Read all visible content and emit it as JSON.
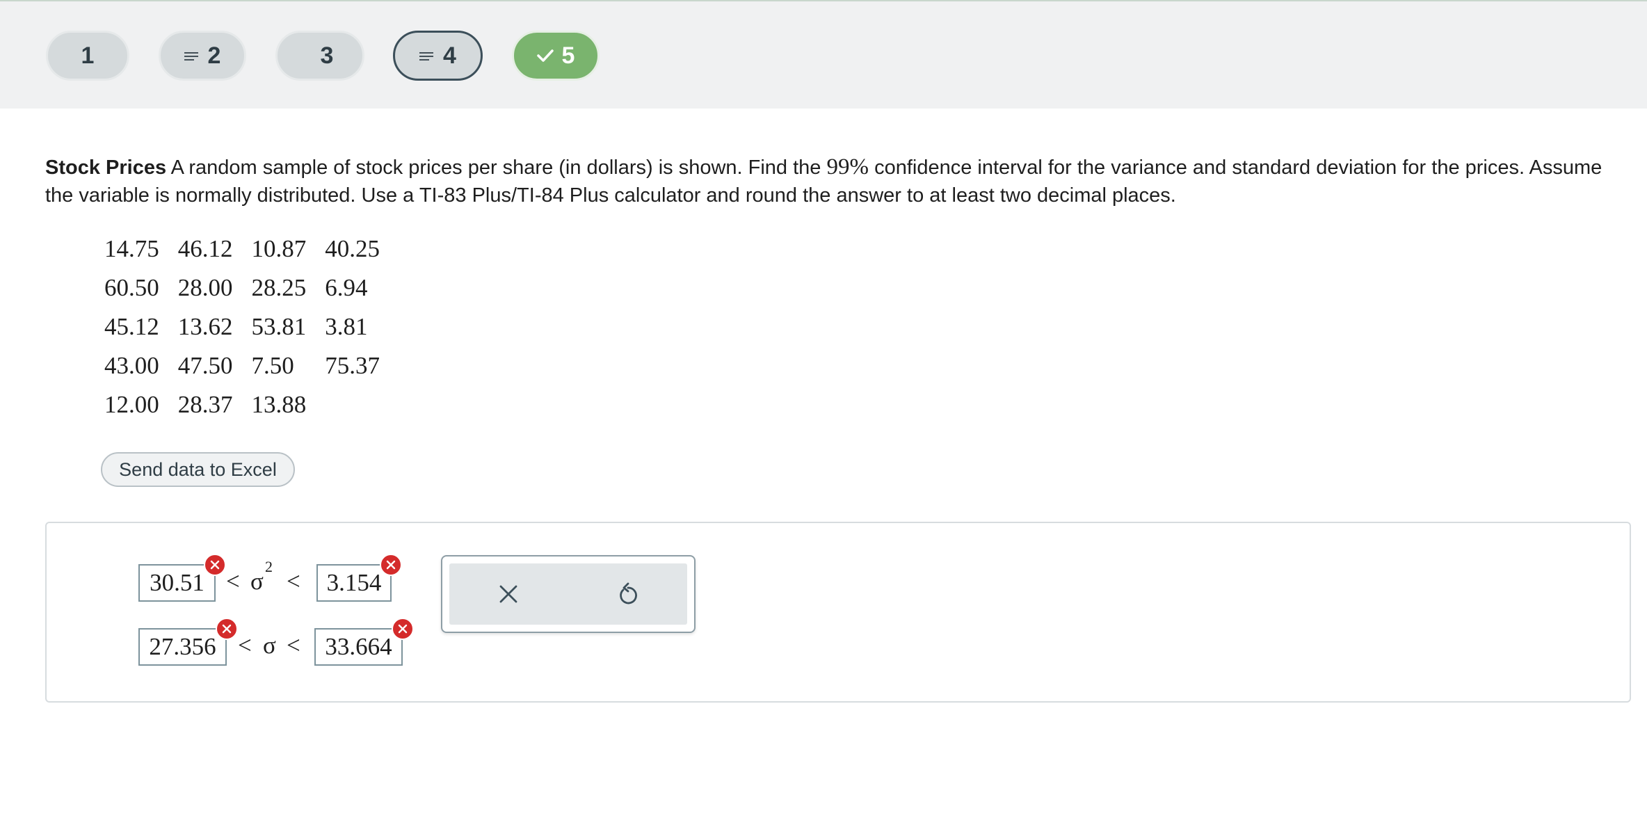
{
  "nav": {
    "pills": [
      {
        "number": "1",
        "state": "default"
      },
      {
        "number": "2",
        "state": "has-notes"
      },
      {
        "number": "3",
        "state": "default"
      },
      {
        "number": "4",
        "state": "active-has-notes"
      },
      {
        "number": "5",
        "state": "correct"
      }
    ]
  },
  "question": {
    "title": "Stock Prices",
    "text_before": "A random sample of stock prices per share (in dollars) is shown. Find the",
    "confidence": "99%",
    "text_after": "confidence interval for the variance and standard deviation for the prices. Assume the variable is normally distributed. Use a TI-83 Plus/TI-84 Plus calculator and round the answer to at least two decimal places."
  },
  "data_table": {
    "rows": [
      [
        "14.75",
        "46.12",
        "10.87",
        "40.25"
      ],
      [
        "60.50",
        "28.00",
        "28.25",
        "6.94"
      ],
      [
        "45.12",
        "13.62",
        "53.81",
        "3.81"
      ],
      [
        "43.00",
        "47.50",
        "7.50",
        "75.37"
      ],
      [
        "12.00",
        "28.37",
        "13.88",
        ""
      ]
    ]
  },
  "excel_button": {
    "label": "Send data to Excel"
  },
  "answers": {
    "variance": {
      "lower": "30.51",
      "lt1": "<",
      "symbol": "σ",
      "exponent": "2",
      "lt2": "<",
      "upper": "3.154"
    },
    "std_dev": {
      "lower": "27.356",
      "lt1": "<",
      "symbol": "σ",
      "lt2": "<",
      "upper": "33.664"
    }
  },
  "tools": {
    "clear": "×",
    "undo": "undo-icon"
  },
  "colors": {
    "correct": "#7ab46e",
    "error": "#d42b2b",
    "active_border": "#3c4f5a"
  }
}
